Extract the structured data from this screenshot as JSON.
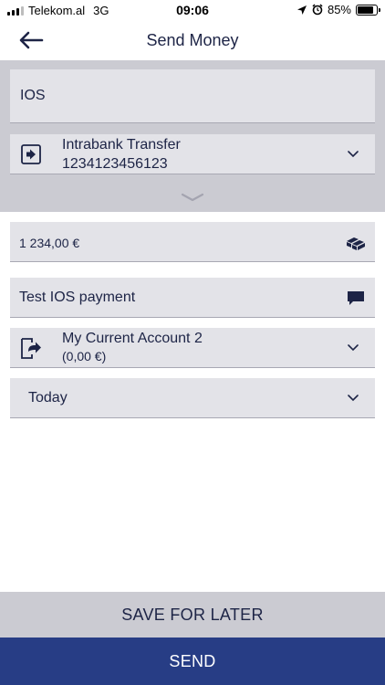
{
  "status_bar": {
    "carrier": "Telekom.al",
    "network": "3G",
    "time": "09:06",
    "battery_label": "85%",
    "battery_level": 0.85
  },
  "header": {
    "title": "Send Money",
    "back_icon": "arrow-left-icon"
  },
  "form": {
    "recipient": "IOS",
    "transfer_type": "Intrabank Transfer",
    "transfer_account": "1234123456123",
    "amount": "1 234,00 €",
    "description": "Test IOS payment",
    "from_account_name": "My Current Account 2",
    "from_account_balance": "(0,00 €)",
    "date": "Today"
  },
  "actions": {
    "save_label": "SAVE FOR LATER",
    "send_label": "SEND"
  },
  "colors": {
    "text": "#1d2446",
    "panel": "#cbcbd2",
    "field": "#e3e3e8",
    "primary": "#273d85"
  }
}
